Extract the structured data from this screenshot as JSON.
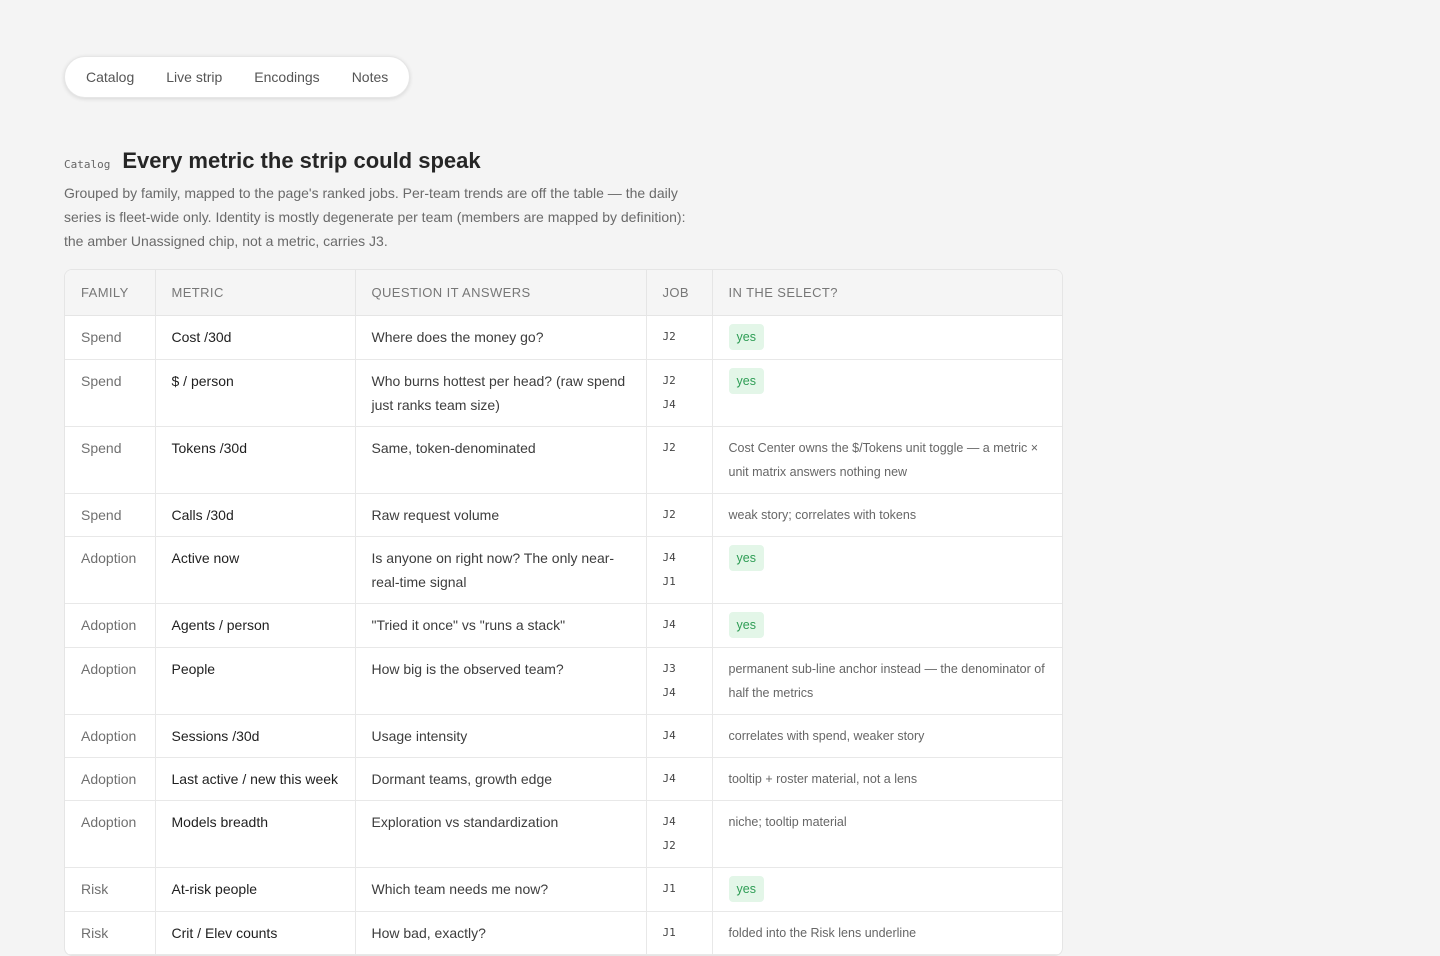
{
  "tabs": [
    "Catalog",
    "Live strip",
    "Encodings",
    "Notes"
  ],
  "section": {
    "eyebrow": "Catalog",
    "title": "Every metric the strip could speak",
    "lede": "Grouped by family, mapped to the page's ranked jobs. Per-team trends are off the table — the daily series is fleet-wide only. Identity is mostly degenerate per team (members are mapped by definition): the amber Unassigned chip, not a metric, carries J3."
  },
  "colors": {
    "badge_bg": "#e3f6e8",
    "badge_text": "#2e9d55"
  },
  "table": {
    "headers": [
      "FAMILY",
      "METRIC",
      "QUESTION IT ANSWERS",
      "JOB",
      "IN THE SELECT?"
    ],
    "rows": [
      {
        "family": "Spend",
        "metric": "Cost /30d",
        "question": "Where does the money go?",
        "job": "J2",
        "select": "yes",
        "badge": true
      },
      {
        "family": "Spend",
        "metric": "$ / person",
        "question": "Who burns hottest per head? (raw spend just ranks team size)",
        "job": "J2 J4",
        "select": "yes",
        "badge": true
      },
      {
        "family": "Spend",
        "metric": "Tokens /30d",
        "question": "Same, token-denominated",
        "job": "J2",
        "select": "Cost Center owns the $/Tokens unit toggle — a metric × unit matrix answers nothing new",
        "badge": false
      },
      {
        "family": "Spend",
        "metric": "Calls /30d",
        "question": "Raw request volume",
        "job": "J2",
        "select": "weak story; correlates with tokens",
        "badge": false
      },
      {
        "family": "Adoption",
        "metric": "Active now",
        "question": "Is anyone on right now? The only near-real-time signal",
        "job": "J4 J1",
        "select": "yes",
        "badge": true
      },
      {
        "family": "Adoption",
        "metric": "Agents / person",
        "question": "\"Tried it once\" vs \"runs a stack\"",
        "job": "J4",
        "select": "yes",
        "badge": true
      },
      {
        "family": "Adoption",
        "metric": "People",
        "question": "How big is the observed team?",
        "job": "J3 J4",
        "select": "permanent sub-line anchor instead — the denominator of half the metrics",
        "badge": false
      },
      {
        "family": "Adoption",
        "metric": "Sessions /30d",
        "question": "Usage intensity",
        "job": "J4",
        "select": "correlates with spend, weaker story",
        "badge": false
      },
      {
        "family": "Adoption",
        "metric": "Last active / new this week",
        "question": "Dormant teams, growth edge",
        "job": "J4",
        "select": "tooltip + roster material, not a lens",
        "badge": false
      },
      {
        "family": "Adoption",
        "metric": "Models breadth",
        "question": "Exploration vs standardization",
        "job": "J4 J2",
        "select": "niche; tooltip material",
        "badge": false
      },
      {
        "family": "Risk",
        "metric": "At-risk people",
        "question": "Which team needs me now?",
        "job": "J1",
        "select": "yes",
        "badge": true
      },
      {
        "family": "Risk",
        "metric": "Crit / Elev counts",
        "question": "How bad, exactly?",
        "job": "J1",
        "select": "folded into the Risk lens underline",
        "badge": false
      }
    ]
  }
}
